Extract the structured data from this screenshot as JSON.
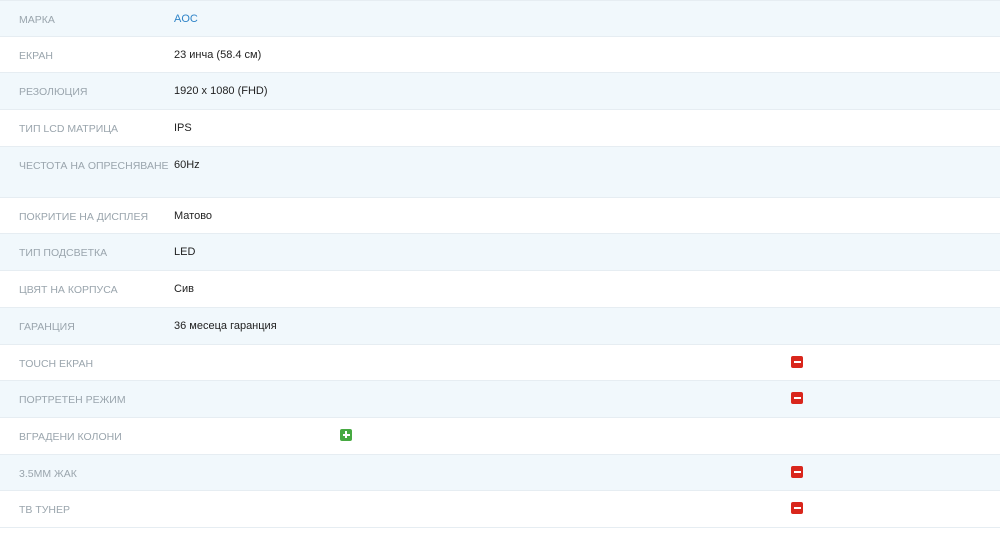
{
  "specs": [
    {
      "label": "МАРКА",
      "value": "AOC",
      "link": true
    },
    {
      "label": "ЕКРАН",
      "value": "23 инча (58.4 см)"
    },
    {
      "label": "РЕЗОЛЮЦИЯ",
      "value": "1920 x 1080 (FHD)"
    },
    {
      "label": "ТИП LCD МАТРИЦА",
      "value": "IPS"
    },
    {
      "label": "ЧЕСТОТА НА ОПРЕСНЯВАНЕ",
      "value": "60Hz"
    },
    {
      "label": "ПОКРИТИЕ НА ДИСПЛЕЯ",
      "value": "Матово"
    },
    {
      "label": "ТИП ПОДСВЕТКА",
      "value": "LED"
    },
    {
      "label": "ЦВЯТ НА КОРПУСА",
      "value": "Сив"
    },
    {
      "label": "ГАРАНЦИЯ",
      "value": "36 месеца гаранция"
    },
    {
      "label": "TOUCH ЕКРАН",
      "icon": "minus-icon",
      "available": false
    },
    {
      "label": "ПОРТРЕТЕН РЕЖИМ",
      "icon": "minus-icon",
      "available": false
    },
    {
      "label": "ВГРАДЕНИ КОЛОНИ",
      "icon": "plus-icon",
      "available": true
    },
    {
      "label": "3.5ММ ЖАК",
      "icon": "minus-icon",
      "available": false
    },
    {
      "label": "ТВ ТУНЕР",
      "icon": "minus-icon",
      "available": false
    }
  ],
  "colors": {
    "row_shade": "#f1f8fc",
    "label": "#9aa5ad",
    "link": "#2f84c8",
    "no_badge": "#d9261c",
    "yes_badge": "#47a942"
  }
}
